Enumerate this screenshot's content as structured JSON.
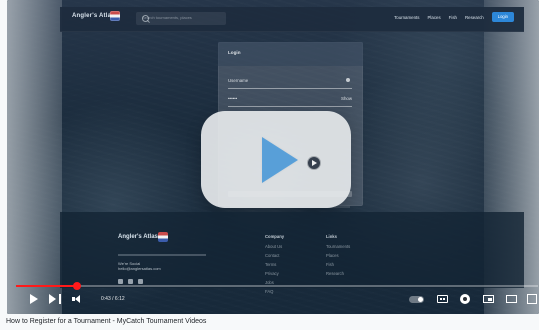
{
  "header": {
    "brand": "Angler's Atlas",
    "search_placeholder": "Search tournaments, places",
    "nav": [
      "Tournaments",
      "Places",
      "Fish",
      "Research",
      "Login"
    ]
  },
  "login": {
    "title": "Login",
    "username_label": "Username",
    "password_value": "••••••",
    "show_label": "Show"
  },
  "footer": {
    "brand": "Angler's Atlas",
    "contact": [
      "We're Social",
      "hello@anglersatlas.com"
    ],
    "company": {
      "title": "Company",
      "items": [
        "About Us",
        "Contact",
        "Terms",
        "Privacy",
        "Jobs",
        "FAQ"
      ]
    },
    "links": {
      "title": "Links",
      "items": [
        "Tournaments",
        "Places",
        "Fish",
        "Research"
      ]
    }
  },
  "player": {
    "current_time": "0:43",
    "duration": "6:12",
    "time_text": "0:43 / 6:12",
    "progress": 0.116
  },
  "video_title": "How to Register for a Tournament - MyCatch Tournament Videos",
  "icons": {
    "play": "play-icon",
    "next": "next-icon",
    "volume": "volume-icon",
    "autoplay": "autoplay-toggle-icon",
    "captions": "captions-icon",
    "settings": "gear-icon",
    "miniplayer": "miniplayer-icon",
    "theater": "theater-mode-icon",
    "fullscreen": "fullscreen-icon"
  },
  "colors": {
    "accent": "#2d87d8",
    "progress": "#ff1a1a",
    "title_text": "#23272c"
  }
}
